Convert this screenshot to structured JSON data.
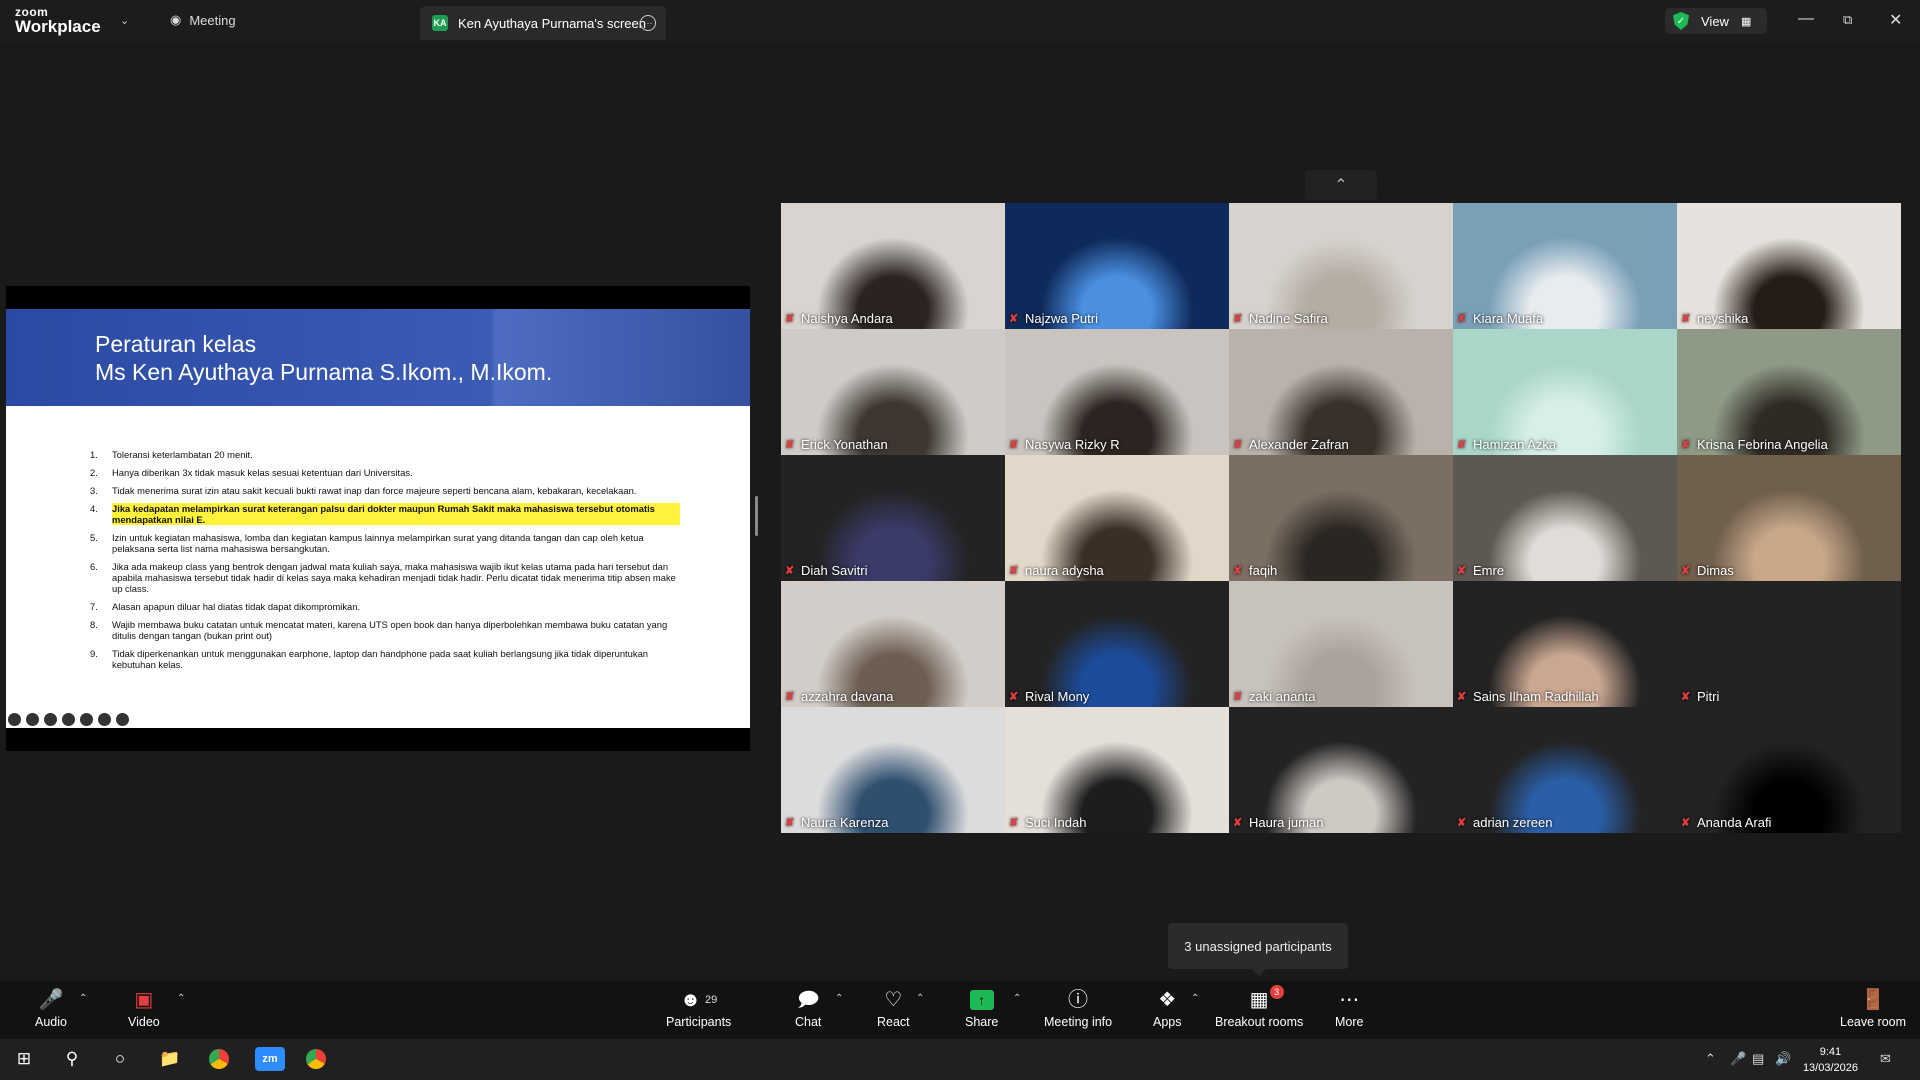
{
  "titlebar": {
    "logo_top": "zoom",
    "logo_bottom": "Workplace",
    "meeting_tab": "Meeting",
    "screen_tab": "Ken Ayuthaya Purnama's screen",
    "screen_tab_badge": "KA",
    "view_label": "View",
    "colors": {
      "secure": "#1db954",
      "badge": "#1f9d55"
    }
  },
  "slide": {
    "title_line1": "Peraturan kelas",
    "title_line2": "Ms Ken Ayuthaya Purnama S.Ikom., M.Ikom.",
    "rules": [
      {
        "n": "1.",
        "text": "Toleransi keterlambatan 20 menit."
      },
      {
        "n": "2.",
        "text": "Hanya diberikan 3x tidak masuk kelas sesuai ketentuan dari Universitas."
      },
      {
        "n": "3.",
        "text": "Tidak menerima surat izin atau sakit kecuali bukti rawat inap dan force majeure seperti bencana alam, kebakaran, kecelakaan."
      },
      {
        "n": "4.",
        "text": "Jika kedapatan melampirkan surat keterangan palsu dari dokter maupun Rumah Sakit maka mahasiswa tersebut otomatis mendapatkan nilai E."
      },
      {
        "n": "5.",
        "text": "Izin untuk kegiatan mahasiswa, lomba dan kegiatan kampus lainnya melampirkan surat yang ditanda tangan dan cap oleh ketua pelaksana serta list nama mahasiswa bersangkutan."
      },
      {
        "n": "6.",
        "text": "Jika ada makeup class yang bentrok dengan jadwal mata kuliah saya, maka mahasiswa wajib ikut kelas utama pada hari tersebut dan apabila mahasiswa tersebut tidak hadir di kelas saya maka kehadiran menjadi tidak hadir. Perlu dicatat tidak menerima titip absen make up class."
      },
      {
        "n": "7.",
        "text": "Alasan apapun diluar hal diatas tidak dapat dikompromikan."
      },
      {
        "n": "8.",
        "text": "Wajib membawa buku catatan untuk mencatat materi, karena UTS open book dan hanya diperbolehkan membawa buku catatan yang ditulis dengan tangan (bukan print out)"
      },
      {
        "n": "9.",
        "text": "Tidak diperkenankan untuk menggunakan earphone, laptop dan handphone pada saat kuliah berlangsung jika tidak diperuntukan kebutuhan kelas."
      }
    ],
    "highlight_color": "#fff23a"
  },
  "participants": [
    {
      "name": "Naishya Andara",
      "bg": "#d9d4cf",
      "accent": "#2a2320"
    },
    {
      "name": "Najzwa Putri",
      "bg": "#0e2a5a",
      "accent": "#4a8fe0"
    },
    {
      "name": "Nadine Safira",
      "bg": "#d6d3ce",
      "accent": "#b5aca3"
    },
    {
      "name": "Kiara Muafa",
      "bg": "#7aa0b8",
      "accent": "#e8ecef"
    },
    {
      "name": "neyshika",
      "bg": "#e6e1dc",
      "accent": "#251c18"
    },
    {
      "name": "Erick Yonathan",
      "bg": "#cfcbc6",
      "accent": "#3d3631"
    },
    {
      "name": "Nasywa Rizky R",
      "bg": "#c9c4bf",
      "accent": "#2b2420"
    },
    {
      "name": "Alexander Zafran",
      "bg": "#b9b2aa",
      "accent": "#3a302a"
    },
    {
      "name": "Hamizan Azka",
      "bg": "#a9d6c8",
      "accent": "#d8efe8"
    },
    {
      "name": "Krisna Febrina Angelia",
      "bg": "#8e9a86",
      "accent": "#2f2a24"
    },
    {
      "name": "Diah Savitri",
      "bg": "#232323",
      "accent": "#3b3b6a"
    },
    {
      "name": "naura adysha",
      "bg": "#e2d8c9",
      "accent": "#3a2e26"
    },
    {
      "name": "faqih",
      "bg": "#7b6f63",
      "accent": "#2b2622"
    },
    {
      "name": "Emre",
      "bg": "#5e5852",
      "accent": "#e0ddd8"
    },
    {
      "name": "Dimas",
      "bg": "#6f5f4d",
      "accent": "#c9a88a"
    },
    {
      "name": "azzahra davana",
      "bg": "#d2cdc8",
      "accent": "#6d5e52"
    },
    {
      "name": "Rival Mony",
      "bg": "#232323",
      "accent": "#1c4c9a"
    },
    {
      "name": "zaki ananta",
      "bg": "#c7c2bb",
      "accent": "#aaa39b"
    },
    {
      "name": "Sains Ilham Radhillah",
      "bg": "#232323",
      "accent": "#c9a791"
    },
    {
      "name": "Pitri",
      "bg": "#232323",
      "accent": "#232323"
    },
    {
      "name": "Naura Karenza",
      "bg": "#dcdcdc",
      "accent": "#2f4f6f"
    },
    {
      "name": "Suci Indah",
      "bg": "#e4dfd9",
      "accent": "#1d1d1d"
    },
    {
      "name": "Haura juman",
      "bg": "#232323",
      "accent": "#cfc9c4"
    },
    {
      "name": "adrian zereen",
      "bg": "#232323",
      "accent": "#2a5fa8"
    },
    {
      "name": "Ananda Arafi",
      "bg": "#232323",
      "accent": "#000000"
    }
  ],
  "tooltip": "3 unassigned participants",
  "toolbar": {
    "audio": "Audio",
    "video": "Video",
    "participants": "Participants",
    "participants_count": "29",
    "chat": "Chat",
    "react": "React",
    "share": "Share",
    "meeting_info": "Meeting info",
    "apps": "Apps",
    "breakout_rooms": "Breakout rooms",
    "breakout_badge": "3",
    "more": "More",
    "leave_room": "Leave room",
    "colors": {
      "share": "#1db954",
      "muted": "#e53e3e"
    }
  },
  "taskbar": {
    "time": "9:41",
    "date": "13/03/2026",
    "zoom_app": "zm"
  }
}
